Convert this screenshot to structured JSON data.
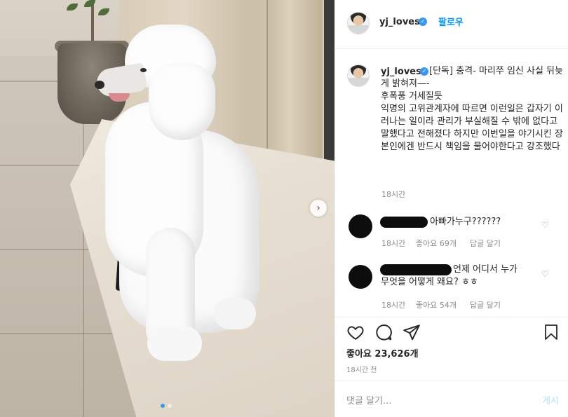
{
  "post": {
    "username": "yj_loves",
    "follow_separator": "•",
    "follow_label": "팔로우",
    "caption": "[단독] 충격- 마리쭈 임신 사실 뒤늦게 밝혀져—-\n후폭풍 거세질듯\n익명의 고위관계자에 따르면 이런일은 갑자기 이러나는 일이라 관리가 부실해질 수 밖에 없다고 말했다고 전해졌다 하지만 이번일을 야기시킨 장본인에겐 반드시 책임을 물어야한다고 강조했다",
    "caption_time": "18시간",
    "likes": "좋아요 23,626개",
    "posted_time": "18시간 전",
    "comment_placeholder": "댓글 달기...",
    "post_button": "게시"
  },
  "comments": [
    {
      "text": "아빠가누구??????",
      "time": "18시간",
      "likes": "좋아요 69개",
      "reply": "답글 달기"
    },
    {
      "text_line1": "언제 어디서 누가",
      "text_line2": "무엇을 어떻게 왜요? ㅎㅎ",
      "time": "18시간",
      "likes": "좋아요 54개",
      "reply": "답글 달기"
    }
  ],
  "icons": {
    "like": "heart-icon",
    "comment": "comment-bubble-icon",
    "share": "paper-plane-icon",
    "save": "bookmark-icon",
    "next": "chevron-right-icon",
    "verified": "verified-badge-icon"
  },
  "colors": {
    "accent": "#0095f6",
    "verified": "#3897f0",
    "muted": "#8e8e8e"
  }
}
